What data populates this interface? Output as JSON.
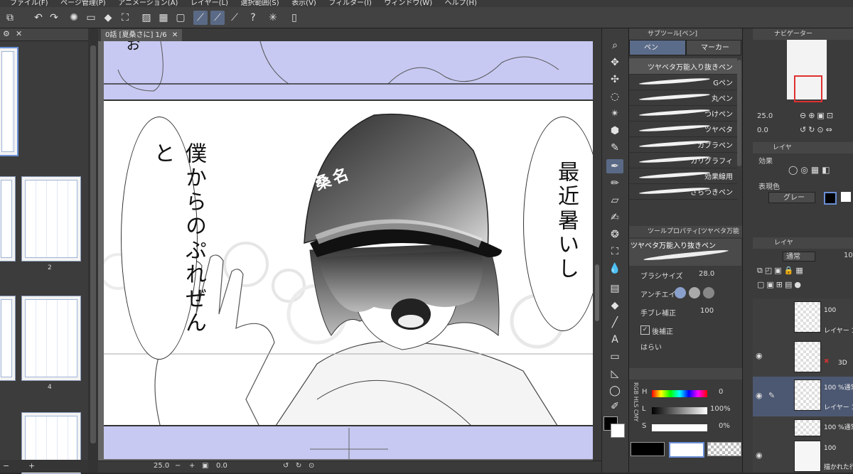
{
  "menu": [
    "ファイル(F)",
    "ページ管理(P)",
    "アニメーション(A)",
    "レイヤー(L)",
    "選択範囲(S)",
    "表示(V)",
    "フィルター(I)",
    "ウィンドウ(W)",
    "ヘルプ(H)"
  ],
  "document": {
    "tab_title": "0話 [夏桑さに] 1/6",
    "cap_text": "桑名",
    "bubble_left": "僕からのぷれぜんと",
    "bubble_right": "最近暑いし",
    "top_fragment": "お"
  },
  "pages": {
    "labels": [
      "2",
      "4"
    ]
  },
  "status": {
    "zoom": "25.0",
    "angle": "0.0"
  },
  "subtool_panel": {
    "title": "サブツール[ペン]",
    "tabs": [
      "ペン",
      "マーカー"
    ],
    "brushes": [
      "ツヤベタ万能入り抜きペン",
      "Gペン",
      "丸ペン",
      "つけペン",
      "ツヤベタ",
      "カブラペン",
      "カリグラフィ",
      "効果線用",
      "ざらつきペン"
    ]
  },
  "tool_property": {
    "title": "ツールプロパティ[ツヤベタ万能入",
    "brush_name": "ツヤベタ万能入り抜きペン",
    "size_label": "ブラシサイズ",
    "size_value": "28.0",
    "antialias_label": "アンチエイリ",
    "stabilization_label": "手ブレ補正",
    "stabilization_value": "100",
    "post_correction_label": "後補正",
    "fade_label": "はらい"
  },
  "color": {
    "h_label": "H",
    "h_value": "0",
    "l_label": "L",
    "l_value": "100%",
    "s_label": "S",
    "s_value": "0%",
    "mode_tabs": [
      "RGB",
      "HLS",
      "CMY"
    ],
    "main_color": "#000000",
    "sub_color": "#ffffff",
    "accent": "#5a6a86"
  },
  "navigator": {
    "title": "ナビゲーター",
    "zoom": "25.0",
    "angle": "0.0"
  },
  "layer_property": {
    "tab": "レイヤ",
    "effect_label": "効果",
    "expression_label": "表現色",
    "expression_value": "グレー"
  },
  "layers_panel": {
    "tab": "レイヤ",
    "blend": "通常",
    "opacity": "10",
    "items": [
      {
        "opacity": "100",
        "name": "レイヤー 1"
      },
      {
        "opacity": "",
        "name": "3D"
      },
      {
        "opacity": "100 %通常",
        "name": "レイヤー 1"
      },
      {
        "opacity": "100 %通常",
        "name": ""
      },
      {
        "opacity": "100",
        "name": "描かれた行が"
      }
    ]
  }
}
